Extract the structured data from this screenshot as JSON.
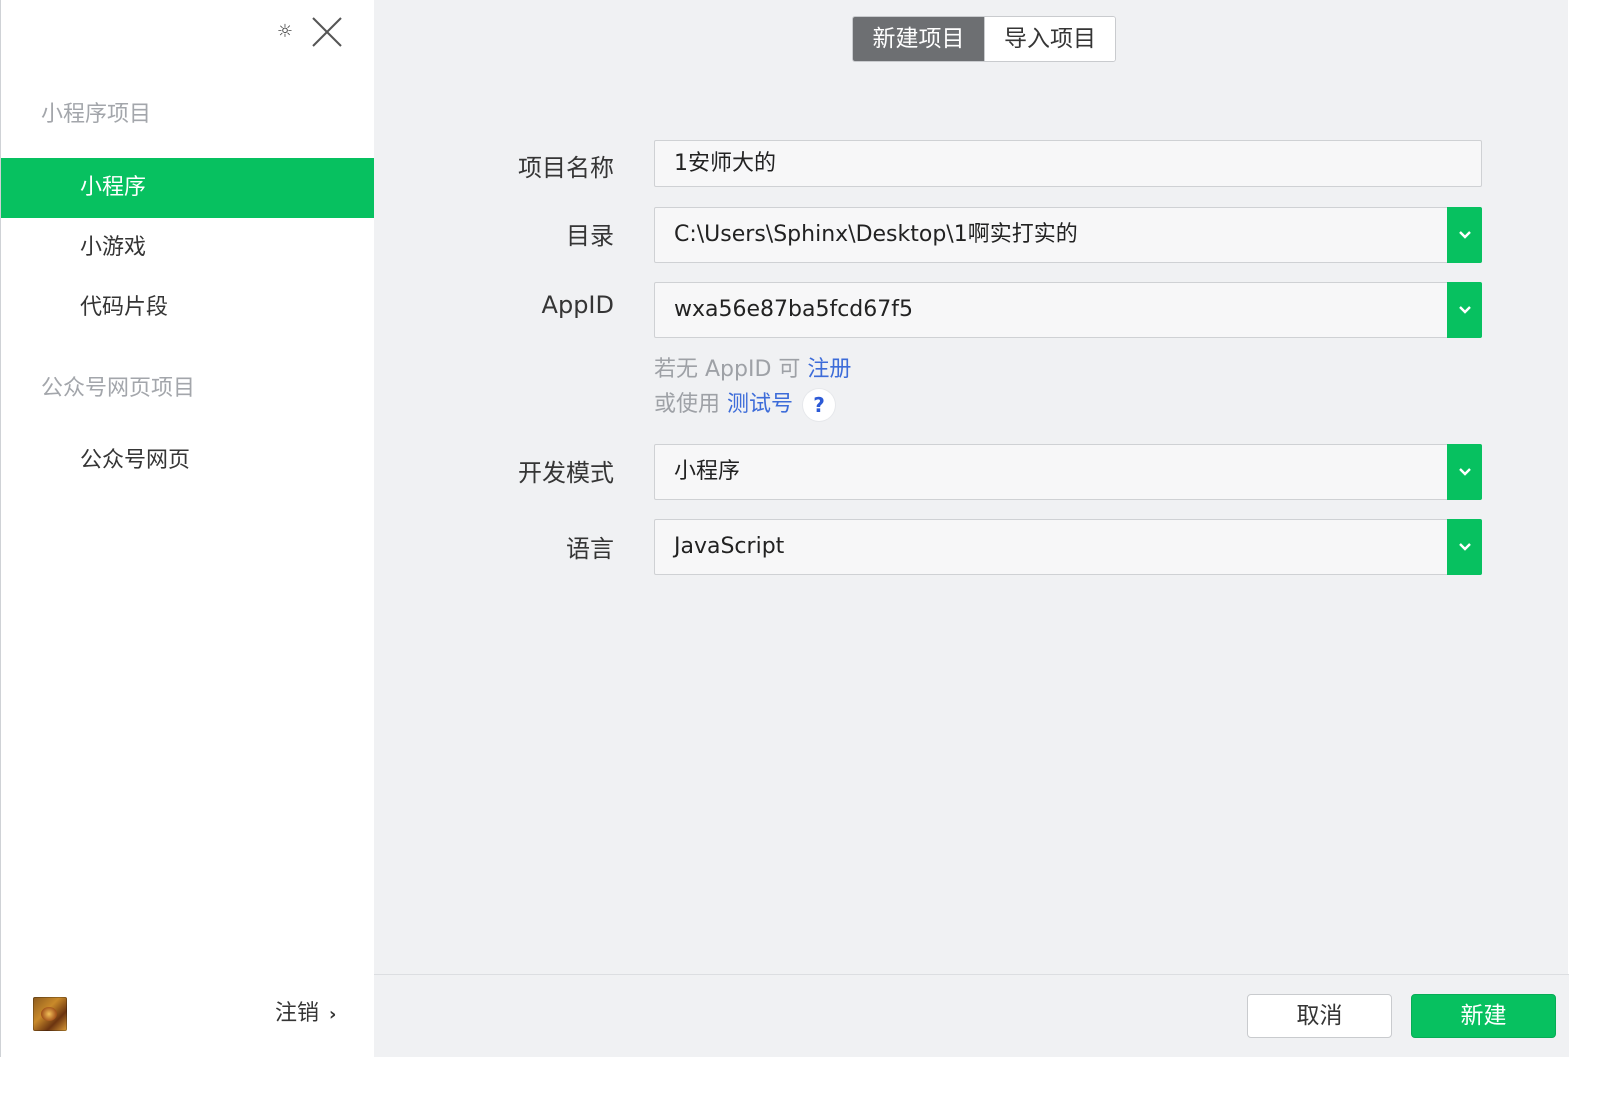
{
  "sidebar": {
    "settings_icon": "gear-icon",
    "close_icon": "close-icon",
    "sections": [
      {
        "title": "小程序项目",
        "items": [
          {
            "label": "小程序",
            "active": true
          },
          {
            "label": "小游戏",
            "active": false
          },
          {
            "label": "代码片段",
            "active": false
          }
        ]
      },
      {
        "title": "公众号网页项目",
        "items": [
          {
            "label": "公众号网页",
            "active": false
          }
        ]
      }
    ],
    "logout_label": "注销",
    "logout_chevron": "›"
  },
  "main": {
    "tabs": [
      {
        "label": "新建项目",
        "active": true
      },
      {
        "label": "导入项目",
        "active": false
      }
    ],
    "form": {
      "project_name": {
        "label": "项目名称",
        "value": "1安师大的"
      },
      "directory": {
        "label": "目录",
        "value": "C:\\Users\\Sphinx\\Desktop\\1啊实打实的"
      },
      "appid": {
        "label": "AppID",
        "value": "wxa56e87ba5fcd67f5"
      },
      "appid_hint": {
        "line1_prefix": "若无 AppID 可 ",
        "line1_link": "注册",
        "line2_prefix": "或使用 ",
        "line2_link": "测试号",
        "help": "?"
      },
      "dev_mode": {
        "label": "开发模式",
        "value": "小程序"
      },
      "language": {
        "label": "语言",
        "value": "JavaScript"
      }
    },
    "footer": {
      "cancel_label": "取消",
      "create_label": "新建"
    }
  },
  "colors": {
    "accent_green": "#07c160",
    "link_blue": "#3d6cd9",
    "tab_active": "#6d6f72"
  }
}
